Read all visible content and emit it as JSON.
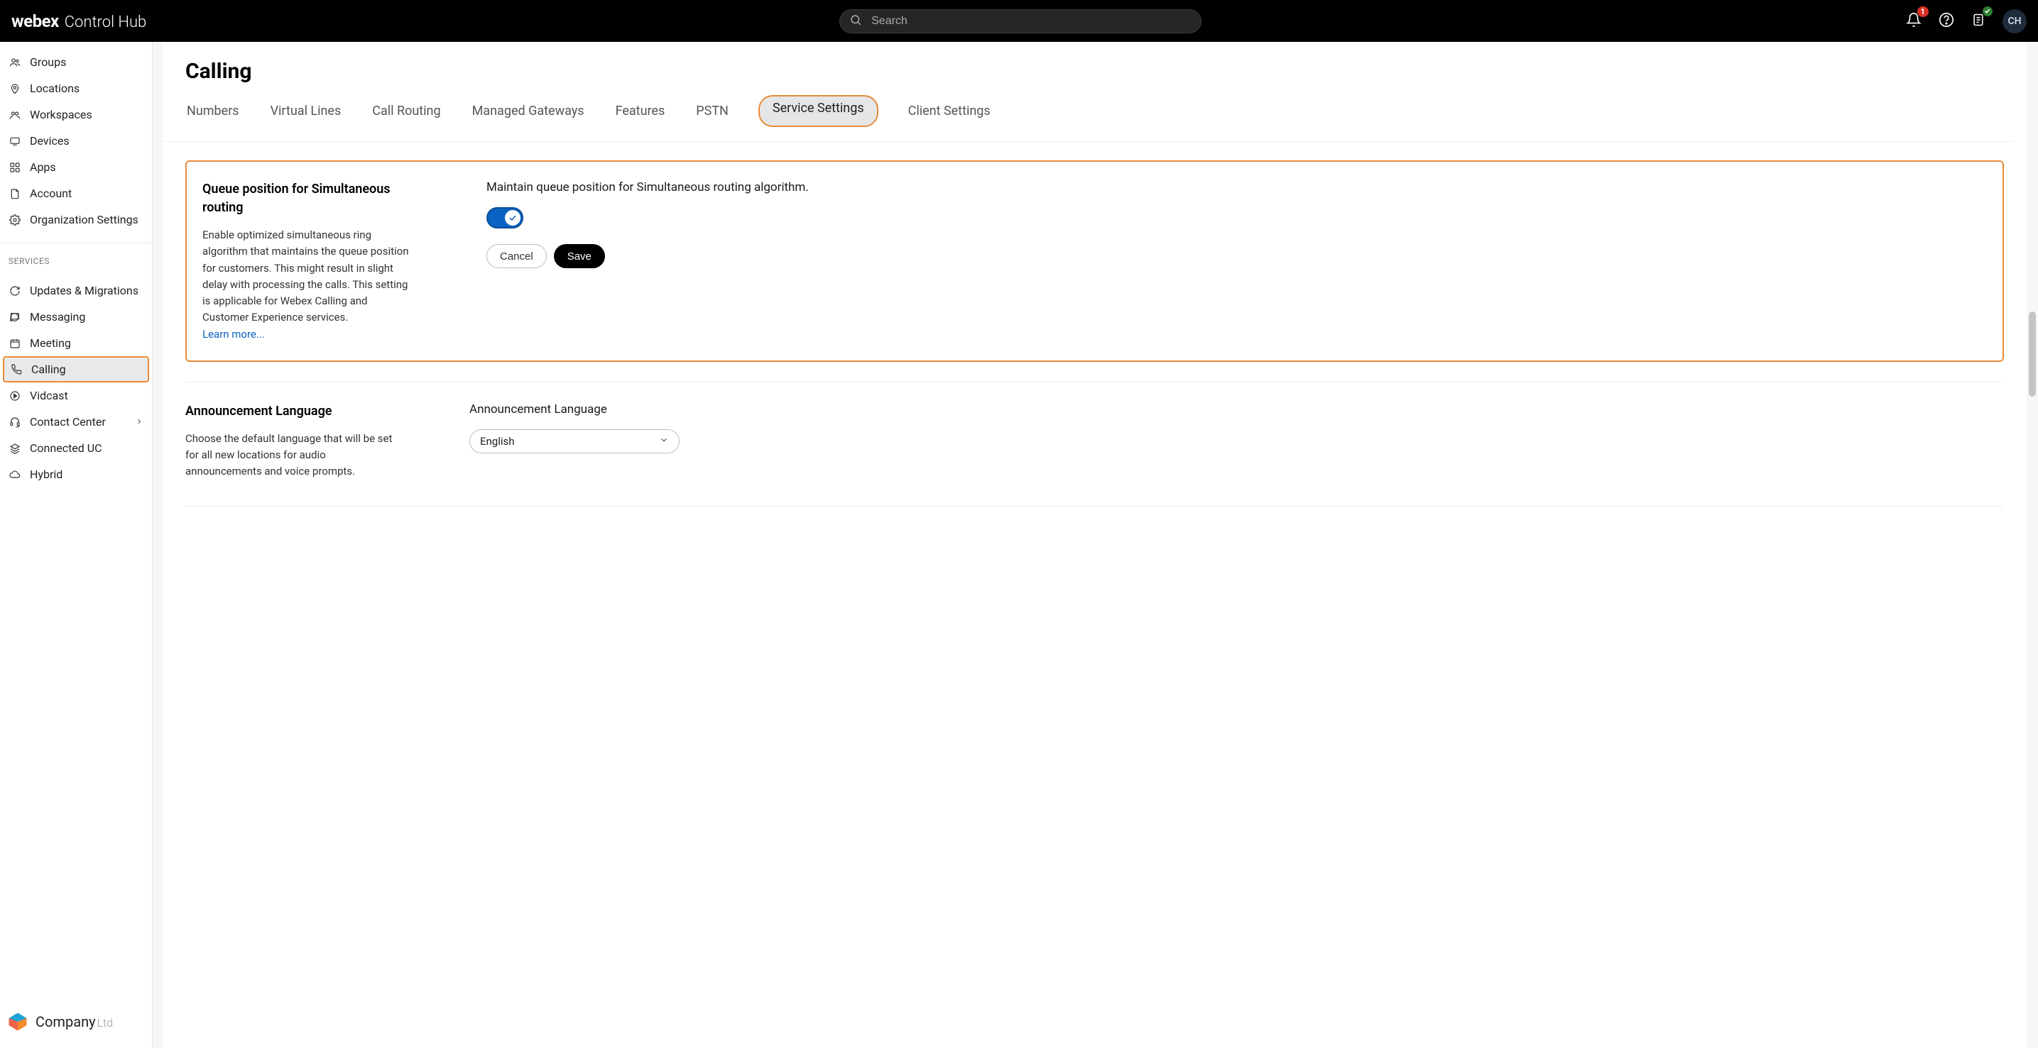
{
  "header": {
    "brand_logo": "webex",
    "brand_sub": "Control Hub",
    "search_placeholder": "Search",
    "notification_count": "1",
    "avatar_initials": "CH"
  },
  "sidebar": {
    "management": [
      {
        "id": "groups",
        "label": "Groups",
        "icon": "users-icon"
      },
      {
        "id": "locations",
        "label": "Locations",
        "icon": "pin-icon"
      },
      {
        "id": "workspaces",
        "label": "Workspaces",
        "icon": "people-icon"
      },
      {
        "id": "devices",
        "label": "Devices",
        "icon": "device-icon"
      },
      {
        "id": "apps",
        "label": "Apps",
        "icon": "grid-icon"
      },
      {
        "id": "account",
        "label": "Account",
        "icon": "file-icon"
      },
      {
        "id": "org-settings",
        "label": "Organization Settings",
        "icon": "gear-icon"
      }
    ],
    "services_header": "SERVICES",
    "services": [
      {
        "id": "updates",
        "label": "Updates & Migrations",
        "icon": "refresh-icon"
      },
      {
        "id": "messaging",
        "label": "Messaging",
        "icon": "chat-icon"
      },
      {
        "id": "meeting",
        "label": "Meeting",
        "icon": "calendar-icon"
      },
      {
        "id": "calling",
        "label": "Calling",
        "icon": "phone-icon",
        "active": true
      },
      {
        "id": "vidcast",
        "label": "Vidcast",
        "icon": "play-icon"
      },
      {
        "id": "contact-center",
        "label": "Contact Center",
        "icon": "headset-icon",
        "chevron": true
      },
      {
        "id": "connected-uc",
        "label": "Connected UC",
        "icon": "stack-icon"
      },
      {
        "id": "hybrid",
        "label": "Hybrid",
        "icon": "cloud-icon"
      }
    ],
    "company_name": "Company",
    "company_suffix": "Ltd"
  },
  "page": {
    "title": "Calling",
    "tabs": [
      {
        "id": "numbers",
        "label": "Numbers"
      },
      {
        "id": "virtual-lines",
        "label": "Virtual Lines"
      },
      {
        "id": "call-routing",
        "label": "Call Routing"
      },
      {
        "id": "managed-gateways",
        "label": "Managed Gateways"
      },
      {
        "id": "features",
        "label": "Features"
      },
      {
        "id": "pstn",
        "label": "PSTN"
      },
      {
        "id": "service-settings",
        "label": "Service Settings",
        "active": true
      },
      {
        "id": "client-settings",
        "label": "Client Settings"
      }
    ]
  },
  "queue_section": {
    "title": "Queue position for Simultaneous routing",
    "desc": "Enable optimized simultaneous ring algorithm that maintains the queue position for customers. This might result in slight delay with processing the calls. This setting is applicable for Webex Calling and Customer Experience services.",
    "learn_more": "Learn more...",
    "right_label": "Maintain queue position for Simultaneous routing algorithm.",
    "toggle_on": true,
    "cancel_label": "Cancel",
    "save_label": "Save"
  },
  "lang_section": {
    "title": "Announcement Language",
    "desc": "Choose the default language that will be set for all new locations for audio announcements and voice prompts.",
    "right_label": "Announcement Language",
    "selected": "English"
  }
}
